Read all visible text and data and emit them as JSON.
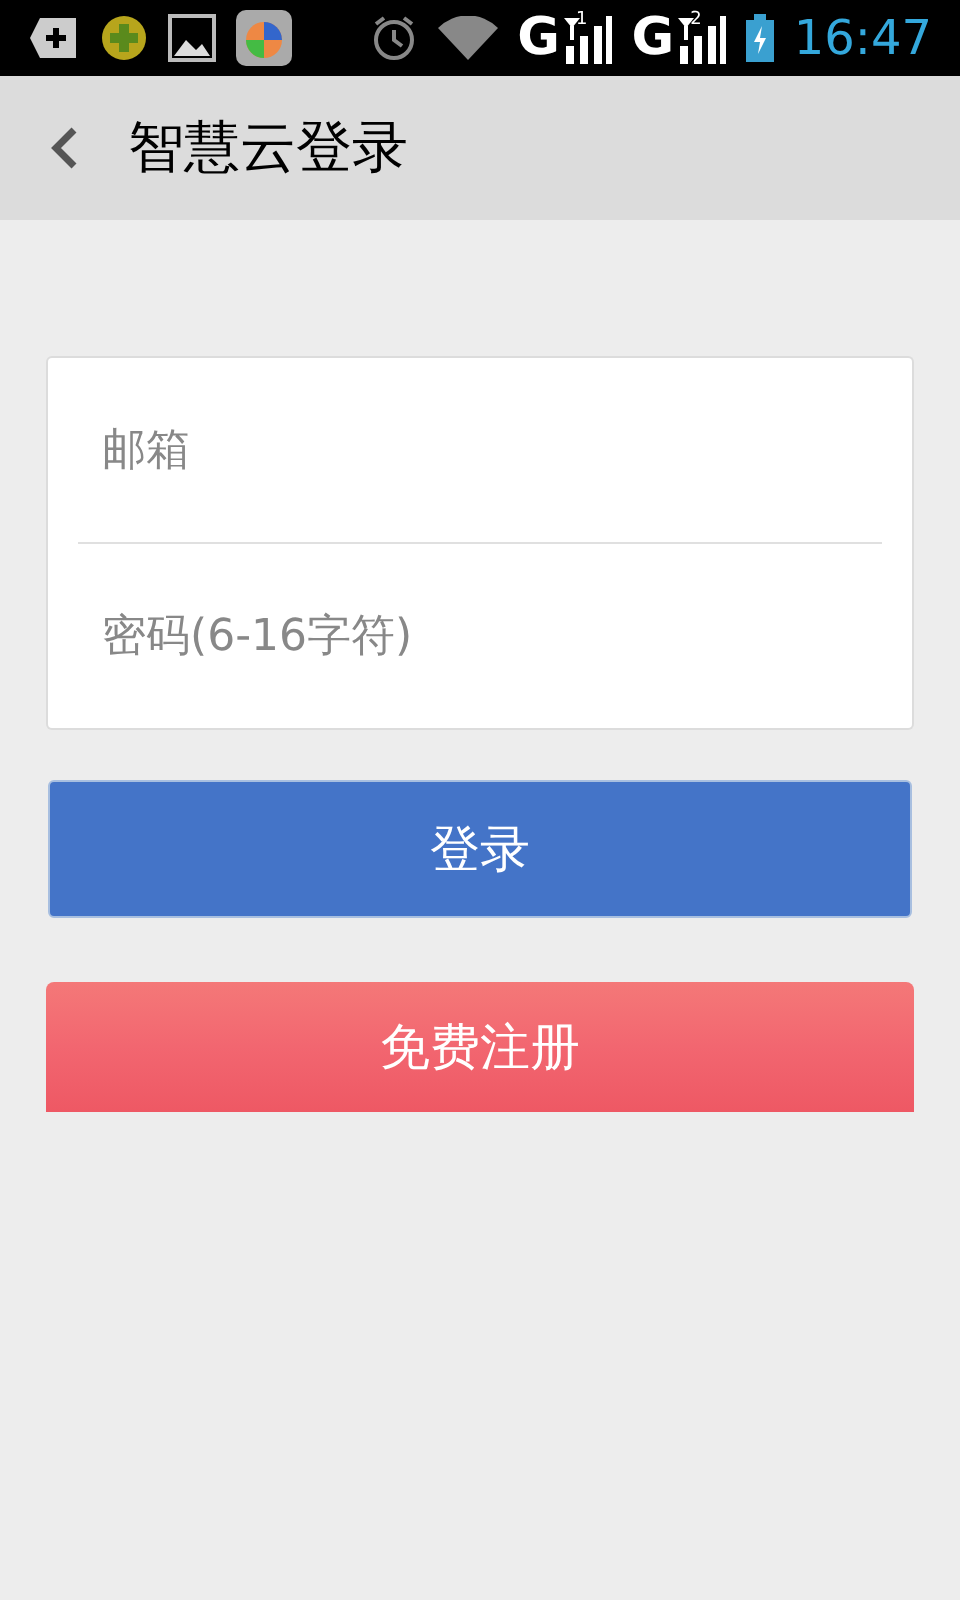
{
  "status_bar": {
    "networks": [
      {
        "label": "G",
        "sim": "1"
      },
      {
        "label": "G",
        "sim": "2"
      }
    ],
    "time": "16:47"
  },
  "header": {
    "title": "智慧云登录"
  },
  "form": {
    "fields": [
      {
        "placeholder": "邮箱"
      },
      {
        "placeholder": "密码(6-16字符)"
      }
    ]
  },
  "buttons": [
    {
      "label": "登录",
      "kind": "primary"
    },
    {
      "label": "免费注册",
      "kind": "danger"
    }
  ]
}
